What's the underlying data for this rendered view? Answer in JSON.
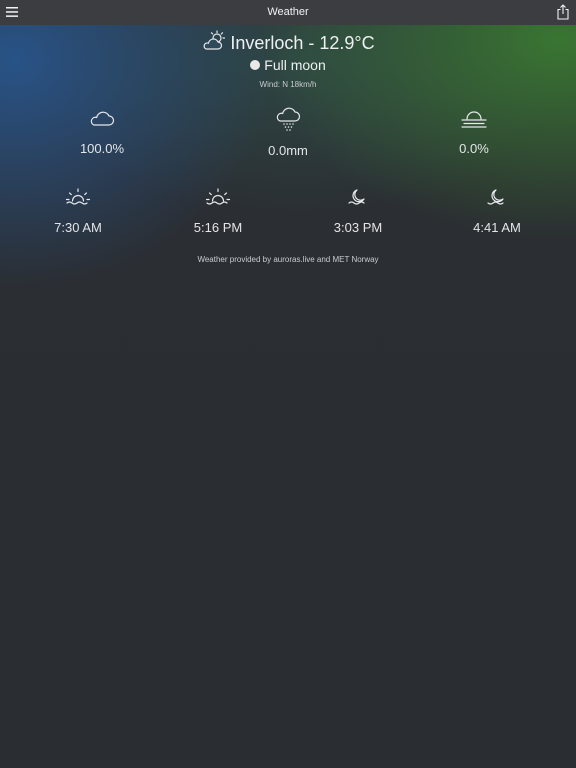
{
  "topbar": {
    "title": "Weather",
    "menu_icon": "hamburger-menu-icon",
    "share_icon": "share-icon"
  },
  "header": {
    "icon": "partly-cloudy-icon",
    "location_temp": "Inverloch - 12.9°C",
    "moon_phase": "Full moon",
    "moon_icon": "full-moon-icon",
    "wind": "Wind: N 18km/h"
  },
  "stats": [
    {
      "icon": "cloud-icon",
      "value": "100.0%"
    },
    {
      "icon": "rain-icon",
      "value": "0.0mm"
    },
    {
      "icon": "fog-icon",
      "value": "0.0%"
    }
  ],
  "times": [
    {
      "icon": "sunrise-icon",
      "value": "7:30 AM"
    },
    {
      "icon": "sunset-icon",
      "value": "5:16 PM"
    },
    {
      "icon": "moonrise-icon",
      "value": "3:03 PM"
    },
    {
      "icon": "moonset-icon",
      "value": "4:41 AM"
    }
  ],
  "footer": {
    "credit": "Weather provided by auroras.live and MET Norway"
  },
  "colors": {
    "topbar": "#3b3d41",
    "background": "#2a2d31",
    "accent_blue": "#285a96",
    "accent_green": "#3c8232",
    "text": "#e6e8ea"
  }
}
